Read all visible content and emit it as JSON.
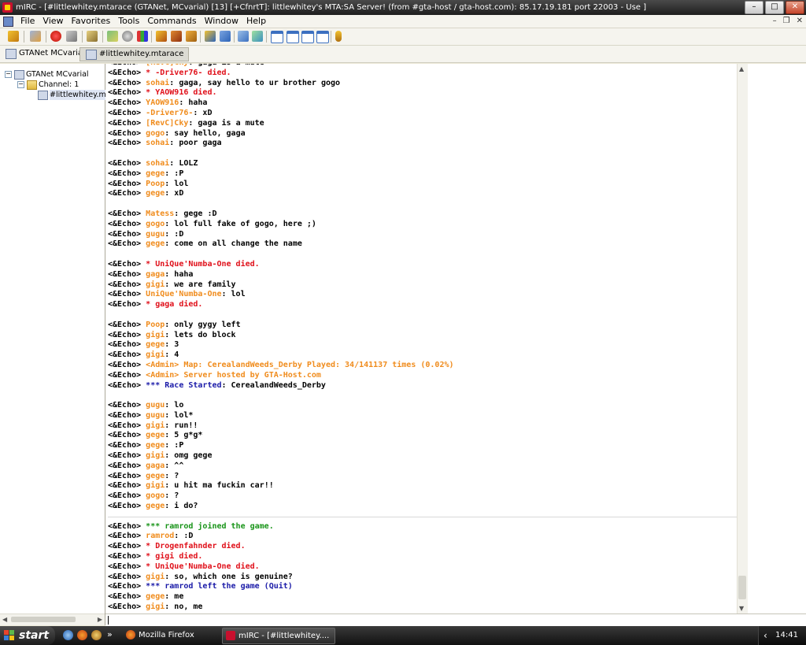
{
  "window": {
    "title": "mIRC - [#littlewhitey.mtarace (GTANet, MCvarial) [13] [+CfnrtT]: littlewhitey's MTA:SA Server! (from #gta-host / gta-host.com): 85.17.19.181 port 22003 - Use ]",
    "min": "–",
    "max": "□",
    "close": "✕"
  },
  "menu": {
    "items": [
      "File",
      "View",
      "Favorites",
      "Tools",
      "Commands",
      "Window",
      "Help"
    ],
    "mdi_min": "–",
    "mdi_restore": "❐",
    "mdi_close": "✕"
  },
  "switchbar": {
    "server_tab": "GTANet MCvarial",
    "channel_tab": "#littlewhitey.mtarace"
  },
  "tree": {
    "server": "GTANet MCvarial",
    "folder": "Channel: 1",
    "channel": "#littlewhitey.mta",
    "expand_server": "−",
    "expand_folder": "−"
  },
  "chat": {
    "lines": [
      {
        "prefix": "<&Echo> ",
        "nick": "[RevC]Cky",
        "text": ": gaga is a mute",
        "kind": "msg",
        "partial": true
      },
      {
        "prefix": "<&Echo> ",
        "nick": "",
        "text": "* -Driver76- died.",
        "kind": "died"
      },
      {
        "prefix": "<&Echo> ",
        "nick": "sohai",
        "text": ": gaga, say hello to ur brother gogo",
        "kind": "msg"
      },
      {
        "prefix": "<&Echo> ",
        "nick": "",
        "text": "* YAOW916 died.",
        "kind": "died"
      },
      {
        "prefix": "<&Echo> ",
        "nick": "YAOW916",
        "text": ": haha",
        "kind": "msg"
      },
      {
        "prefix": "<&Echo> ",
        "nick": "-Driver76-",
        "text": ": xD",
        "kind": "msg"
      },
      {
        "prefix": "<&Echo> ",
        "nick": "[RevC]Cky",
        "text": ": gaga is a mute",
        "kind": "msg"
      },
      {
        "prefix": "<&Echo> ",
        "nick": "gogo",
        "text": ": say hello, gaga",
        "kind": "msg"
      },
      {
        "prefix": "<&Echo> ",
        "nick": "sohai",
        "text": ": poor gaga",
        "kind": "msg"
      },
      {
        "kind": "blank"
      },
      {
        "prefix": "<&Echo> ",
        "nick": "sohai",
        "text": ": LOLZ",
        "kind": "msg"
      },
      {
        "prefix": "<&Echo> ",
        "nick": "gege",
        "text": ": :P",
        "kind": "msg"
      },
      {
        "prefix": "<&Echo> ",
        "nick": "Poop",
        "text": ": lol",
        "kind": "msg"
      },
      {
        "prefix": "<&Echo> ",
        "nick": "gege",
        "text": ": xD",
        "kind": "msg"
      },
      {
        "kind": "blank"
      },
      {
        "prefix": "<&Echo> ",
        "nick": "Matess",
        "text": ": gege :D",
        "kind": "msg"
      },
      {
        "prefix": "<&Echo> ",
        "nick": "gogo",
        "text": ": lol full fake of gogo, here ;)",
        "kind": "msg"
      },
      {
        "prefix": "<&Echo> ",
        "nick": "gugu",
        "text": ": :D",
        "kind": "msg"
      },
      {
        "prefix": "<&Echo> ",
        "nick": "gege",
        "text": ": come on all change the name",
        "kind": "msg"
      },
      {
        "kind": "blank"
      },
      {
        "prefix": "<&Echo> ",
        "nick": "",
        "text": "* UniQue'Numba-One died.",
        "kind": "died"
      },
      {
        "prefix": "<&Echo> ",
        "nick": "gaga",
        "text": ": haha",
        "kind": "msg"
      },
      {
        "prefix": "<&Echo> ",
        "nick": "gigi",
        "text": ": we are family",
        "kind": "msg"
      },
      {
        "prefix": "<&Echo> ",
        "nick": "UniQue'Numba-One",
        "text": ": lol",
        "kind": "msg"
      },
      {
        "prefix": "<&Echo> ",
        "nick": "",
        "text": "* gaga died.",
        "kind": "died"
      },
      {
        "kind": "blank"
      },
      {
        "prefix": "<&Echo> ",
        "nick": "Poop",
        "text": ": only gygy left",
        "kind": "msg"
      },
      {
        "prefix": "<&Echo> ",
        "nick": "gigi",
        "text": ": lets do block",
        "kind": "msg"
      },
      {
        "prefix": "<&Echo> ",
        "nick": "gege",
        "text": ": 3",
        "kind": "msg"
      },
      {
        "prefix": "<&Echo> ",
        "nick": "gigi",
        "text": ": 4",
        "kind": "msg"
      },
      {
        "prefix": "<&Echo> ",
        "nick": "",
        "text": "<Admin> Map: CerealandWeeds_Derby Played: 34/141137 times (0.02%)",
        "kind": "admin"
      },
      {
        "prefix": "<&Echo> ",
        "nick": "",
        "text": "<Admin> Server hosted by GTA-Host.com",
        "kind": "admin"
      },
      {
        "prefix": "<&Echo> ",
        "nick": "",
        "text": "*** Race Started",
        "text2": ": CerealandWeeds_Derby",
        "kind": "race"
      },
      {
        "kind": "blank"
      },
      {
        "prefix": "<&Echo> ",
        "nick": "gugu",
        "text": ": lo",
        "kind": "msg"
      },
      {
        "prefix": "<&Echo> ",
        "nick": "gugu",
        "text": ": lol*",
        "kind": "msg"
      },
      {
        "prefix": "<&Echo> ",
        "nick": "gigi",
        "text": ": run!!",
        "kind": "msg"
      },
      {
        "prefix": "<&Echo> ",
        "nick": "gege",
        "text": ": 5 g*g*",
        "kind": "msg"
      },
      {
        "prefix": "<&Echo> ",
        "nick": "gege",
        "text": ": :P",
        "kind": "msg"
      },
      {
        "prefix": "<&Echo> ",
        "nick": "gigi",
        "text": ": omg gege",
        "kind": "msg"
      },
      {
        "prefix": "<&Echo> ",
        "nick": "gaga",
        "text": ": ^^",
        "kind": "msg"
      },
      {
        "prefix": "<&Echo> ",
        "nick": "gege",
        "text": ": ?",
        "kind": "msg"
      },
      {
        "prefix": "<&Echo> ",
        "nick": "gigi",
        "text": ": u hit ma fuckin car!!",
        "kind": "msg"
      },
      {
        "prefix": "<&Echo> ",
        "nick": "gogo",
        "text": ": ?",
        "kind": "msg"
      },
      {
        "prefix": "<&Echo> ",
        "nick": "gege",
        "text": ": i do?",
        "kind": "msg"
      },
      {
        "kind": "marker"
      },
      {
        "prefix": "<&Echo> ",
        "nick": "",
        "text": "*** ramrod joined the game.",
        "kind": "join"
      },
      {
        "prefix": "<&Echo> ",
        "nick": "ramrod",
        "text": ": :D",
        "kind": "msg"
      },
      {
        "prefix": "<&Echo> ",
        "nick": "",
        "text": "* Drogenfahnder died.",
        "kind": "died"
      },
      {
        "prefix": "<&Echo> ",
        "nick": "",
        "text": "* gigi died.",
        "kind": "died"
      },
      {
        "prefix": "<&Echo> ",
        "nick": "",
        "text": "* UniQue'Numba-One died.",
        "kind": "died"
      },
      {
        "prefix": "<&Echo> ",
        "nick": "gigi",
        "text": ": so, which one is genuine?",
        "kind": "msg"
      },
      {
        "prefix": "<&Echo> ",
        "nick": "",
        "text": "*** ramrod left the game (Quit)",
        "kind": "leave"
      },
      {
        "prefix": "<&Echo> ",
        "nick": "gege",
        "text": ": me",
        "kind": "msg"
      },
      {
        "prefix": "<&Echo> ",
        "nick": "gigi",
        "text": ": no, me",
        "kind": "msg"
      }
    ]
  },
  "taskbar": {
    "start": "start",
    "more": "»",
    "tasks": [
      "Mozilla Firefox",
      "mIRC - [#littlewhitey...."
    ],
    "tray_arrow": "‹",
    "clock": "14:41"
  },
  "colors": {
    "nick": "#f08c1d",
    "died": "#e0101a",
    "race": "#1a1aa8",
    "join": "#189418"
  }
}
